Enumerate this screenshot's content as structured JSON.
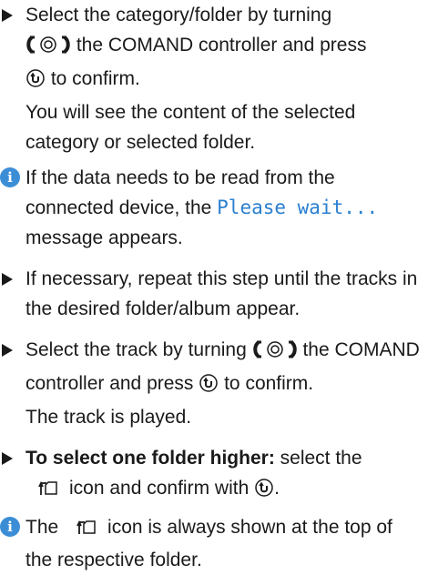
{
  "steps": [
    {
      "line1": "Select the category/folder by turning",
      "line2_after_icon": " the COMAND controller and press",
      "line3_after_icon": " to confirm.",
      "result": "You will see the content of the selected category or selected folder."
    },
    {
      "line1": "If necessary, repeat this step until the tracks in the desired folder/album appear."
    },
    {
      "text_before_icon": "Select the track by turning ",
      "text_mid": " the COMAND controller and press ",
      "text_end": " to confirm.",
      "result": "The track is played."
    },
    {
      "bold": "To select one folder higher:",
      "text_before_icon": " select the",
      "text_after_icon": "icon and confirm with ",
      "text_end": "."
    }
  ],
  "notes": [
    {
      "icon_letter": "i",
      "text_before": "If the data needs to be read from the connected device, the ",
      "mono": "Please wait...",
      "text_after": " message appears."
    },
    {
      "icon_letter": "i",
      "text_before": "The ",
      "text_after": "icon is always shown at the top of the respective folder."
    }
  ],
  "icons": {
    "controller": "controller-turn-icon",
    "press": "controller-press-icon",
    "folder_up": "folder-up-icon",
    "info": "info-icon",
    "step": "step-arrow-icon"
  },
  "colors": {
    "text": "#1a1a1a",
    "info_blue": "#3b8ed6",
    "display_text": "#2a7fd0"
  }
}
